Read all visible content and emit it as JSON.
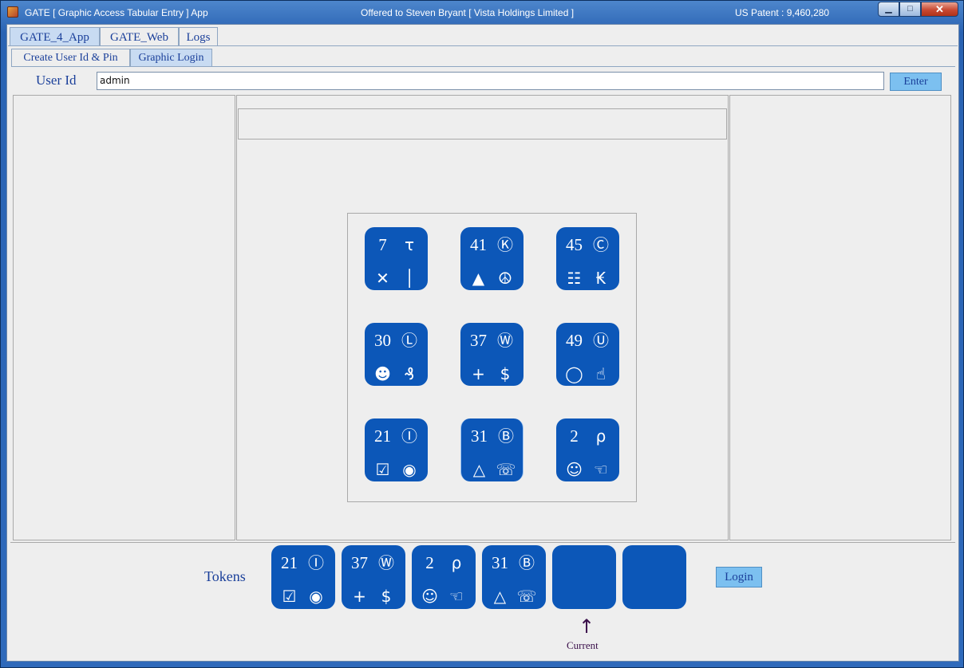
{
  "window": {
    "title": "GATE [ Graphic Access Tabular Entry ] App",
    "offered_to": "Offered to Steven Bryant [ Vista Holdings Limited ]",
    "patent": "US Patent : 9,460,280",
    "minimize_glyph": "▁",
    "maximize_glyph": "□",
    "close_glyph": "✕"
  },
  "main_tabs": [
    {
      "label": "GATE_4_App",
      "active": true
    },
    {
      "label": "GATE_Web",
      "active": false
    },
    {
      "label": "Logs",
      "active": false
    }
  ],
  "sub_tabs": [
    {
      "label": "Create User Id & Pin",
      "active": false
    },
    {
      "label": "Graphic Login",
      "active": true
    }
  ],
  "login": {
    "userid_label": "User Id",
    "userid_value": "admin",
    "enter_label": "Enter"
  },
  "grid": [
    {
      "num": "7",
      "tr": "τ",
      "bl": "✕",
      "br": "│"
    },
    {
      "num": "41",
      "tr": "Ⓚ",
      "bl": "▲",
      "br": "☮"
    },
    {
      "num": "45",
      "tr": "Ⓒ",
      "bl": "☷",
      "br": "₭"
    },
    {
      "num": "30",
      "tr": "Ⓛ",
      "bl": "☻",
      "br": "₰"
    },
    {
      "num": "37",
      "tr": "Ⓦ",
      "bl": "+",
      "br": "$"
    },
    {
      "num": "49",
      "tr": "Ⓤ",
      "bl": "◯",
      "br": "☝"
    },
    {
      "num": "21",
      "tr": "Ⓘ",
      "bl": "☑",
      "br": "◉"
    },
    {
      "num": "31",
      "tr": "Ⓑ",
      "bl": "△",
      "br": "☏"
    },
    {
      "num": "2",
      "tr": "ρ",
      "bl": "☺",
      "br": "☜"
    }
  ],
  "tokens": {
    "label": "Tokens",
    "items": [
      {
        "num": "21",
        "tr": "Ⓘ",
        "bl": "☑",
        "br": "◉"
      },
      {
        "num": "37",
        "tr": "Ⓦ",
        "bl": "+",
        "br": "$"
      },
      {
        "num": "2",
        "tr": "ρ",
        "bl": "☺",
        "br": "☜"
      },
      {
        "num": "31",
        "tr": "Ⓑ",
        "bl": "△",
        "br": "☏"
      },
      {
        "num": "",
        "tr": "",
        "bl": "",
        "br": ""
      },
      {
        "num": "",
        "tr": "",
        "bl": "",
        "br": ""
      }
    ],
    "current_arrow": "↑",
    "current_label": "Current",
    "login_label": "Login"
  },
  "colors": {
    "tile_blue": "#0c57b8",
    "button_light_blue": "#7cc0f0",
    "label_blue": "#1a3f9a",
    "frame_blue": "#2f6abb"
  }
}
